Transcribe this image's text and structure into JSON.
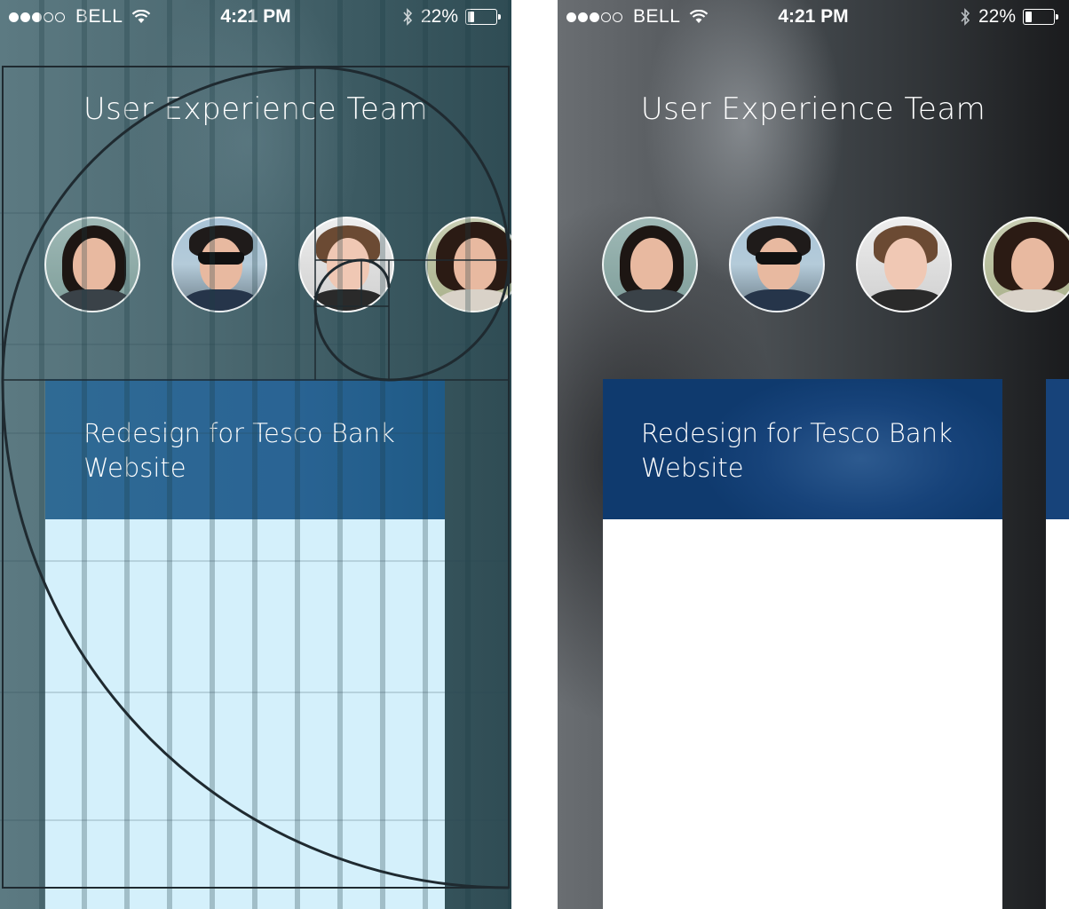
{
  "screens": [
    {
      "id": "left",
      "variant": "grid-overlay",
      "status_bar": {
        "signal_filled": 3,
        "signal_total": 5,
        "carrier": "BELL",
        "time": "4:21 PM",
        "battery": "22%",
        "battery_level": 0.22
      },
      "header": {
        "title": "User Experience Team"
      },
      "team_members": [
        "avatar-1",
        "avatar-2",
        "avatar-3",
        "avatar-4"
      ],
      "card": {
        "title": "Redesign for Tesco Bank Website"
      }
    },
    {
      "id": "right",
      "variant": "final",
      "status_bar": {
        "signal_filled": 3,
        "signal_total": 5,
        "carrier": "BELL",
        "time": "4:21 PM",
        "battery": "22%",
        "battery_level": 0.22
      },
      "header": {
        "title": "User Experience Team"
      },
      "team_members": [
        "avatar-1",
        "avatar-2",
        "avatar-3",
        "avatar-4"
      ],
      "card": {
        "title": "Redesign for Tesco Bank Website"
      }
    }
  ],
  "colors": {
    "card_header": "#17437a",
    "grid_overlay_tint": "#d4f0fb",
    "text": "#ffffff"
  }
}
